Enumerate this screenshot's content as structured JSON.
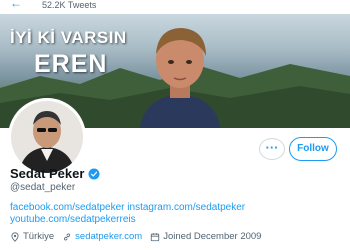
{
  "header": {
    "back_icon": "arrow-left-icon",
    "tweet_count": "52.2K Tweets"
  },
  "banner": {
    "line1": "İYİ Kİ VARSIN",
    "line2": "EREN"
  },
  "actions": {
    "more_label": "···",
    "follow_label": "Follow"
  },
  "profile": {
    "name": "Sedat Peker",
    "handle": "@sedat_peker",
    "verified_icon": "verified-badge-icon",
    "bio_line1": "facebook.com/sedatpeker instagram.com/sedatpeker",
    "bio_line2": "youtube.com/sedatpekerreis",
    "location": "Türkiye",
    "website": "sedatpeker.com",
    "joined": "Joined December 2009"
  },
  "colors": {
    "accent": "#1d9bf0",
    "secondary_text": "#536471",
    "primary_text": "#0f1419"
  }
}
